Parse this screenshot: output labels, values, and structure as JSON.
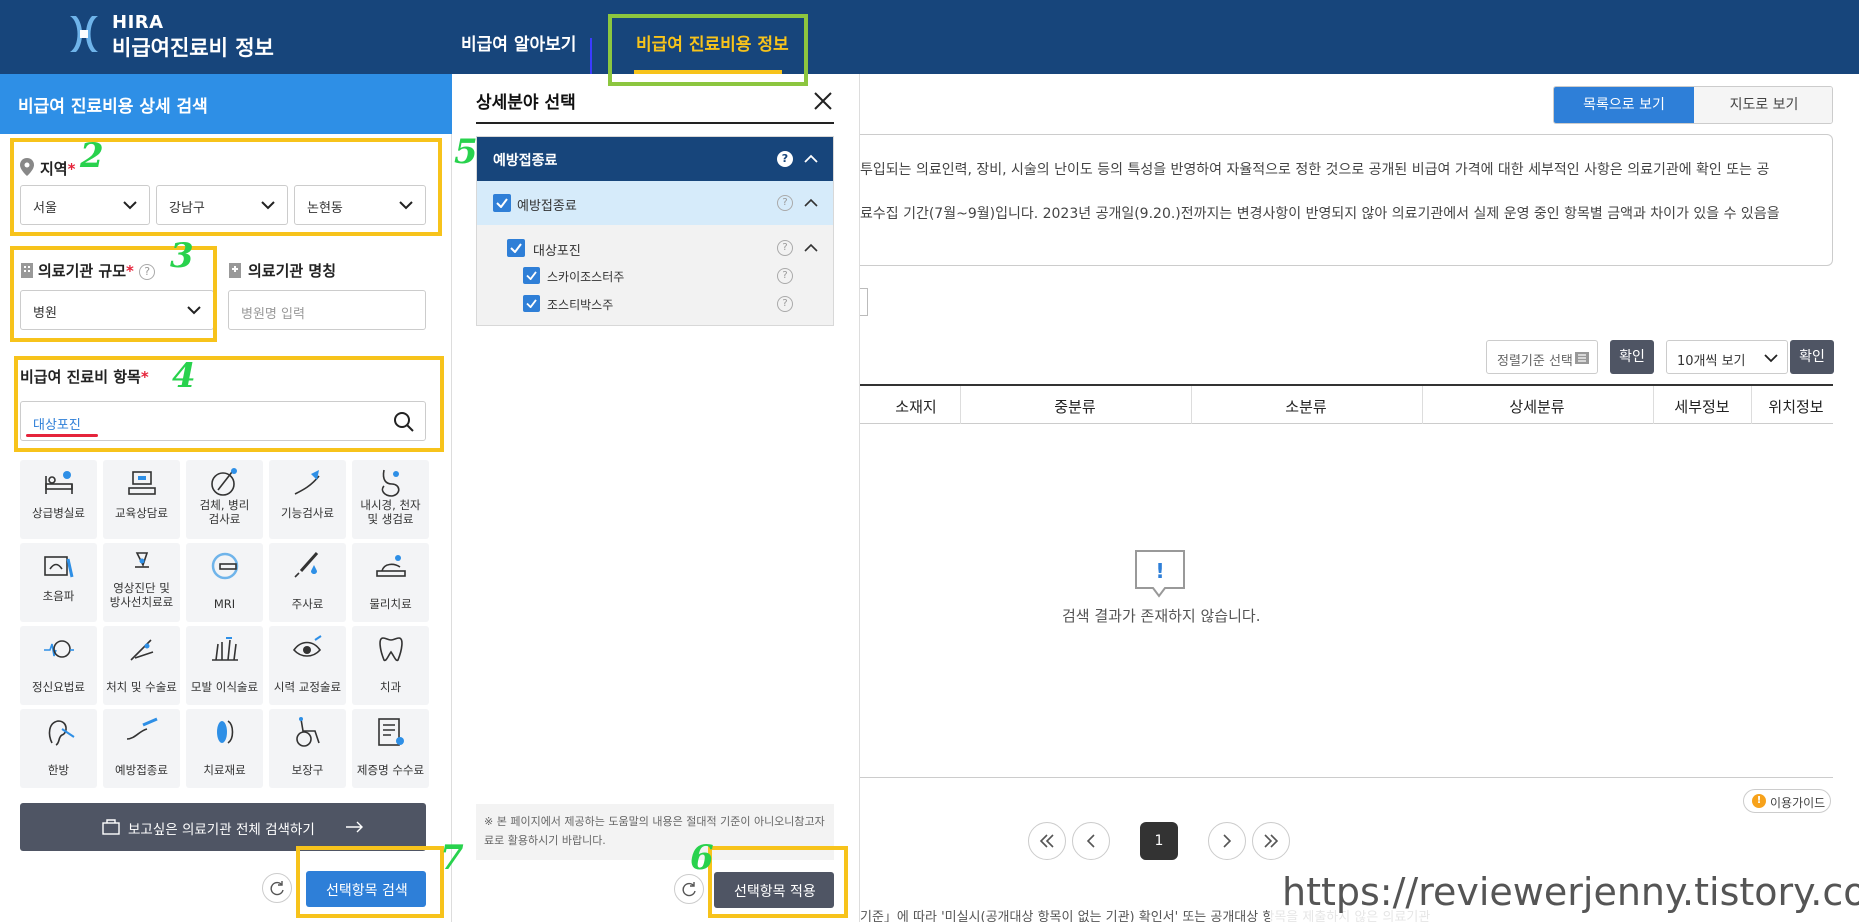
{
  "header": {
    "brand_line1": "HIRA",
    "brand_line2": "비급여진료비 정보",
    "nav": [
      "비급여 알아보기",
      "비급여 진료비용 정보"
    ]
  },
  "search_panel": {
    "title": "비급여 진료비용 상세 검색",
    "region_label": "지역",
    "region_values": [
      "서울",
      "강남구",
      "논현동"
    ],
    "scale_label": "의료기관 규모",
    "scale_value": "병원",
    "name_label": "의료기관 명칭",
    "name_placeholder": "병원명 입력",
    "item_label": "비급여 진료비 항목",
    "item_value": "대상포진",
    "required_mark": "*",
    "categories": [
      "상급병실료",
      "교육상담료",
      "검체, 병리\n검사료",
      "기능검사료",
      "내시경, 천자\n및 생검료",
      "초음파",
      "영상진단 및\n방사선치료료",
      "MRI",
      "주사료",
      "물리치료",
      "정신요법료",
      "처치 및 수술료",
      "모발 이식술료",
      "시력 교정술료",
      "치과",
      "한방",
      "예방접종료",
      "치료재료",
      "보장구",
      "제증명 수수료"
    ],
    "all_search_button": "보고싶은 의료기관 전체 검색하기",
    "search_button": "선택항목 검색"
  },
  "detail_popup": {
    "title": "상세분야 선택",
    "group": "예방접종료",
    "subgroup": "예방접종료",
    "item": "대상포진",
    "children": [
      "스카이조스터주",
      "조스티박스주"
    ],
    "notice": "※ 본 페이지에서 제공하는 도움말의 내용은 절대적 기준이 아니오니참고자료로 활용하시기 바랍니다.",
    "apply_button": "선택항목 적용"
  },
  "results": {
    "view_list": "목록으로 보기",
    "view_map": "지도로 보기",
    "info_line1": "투입되는 의료인력, 장비, 시술의 난이도 등의 특성을 반영하여 자율적으로 정한 것으로 공개된 비급여 가격에 대한 세부적인 사항은 의료기관에 확인 또는 공",
    "info_line2": "료수집 기간(7월~9월)입니다. 2023년 공개일(9.20.)전까지는 변경사항이 반영되지 않아 의료기관에서 실제 운영 중인 항목별 금액과 차이가 있을 수 있음을",
    "sort_label": "정렬기준 선택",
    "confirm": "확인",
    "per_page": "10개씩 보기",
    "columns": [
      "소재지",
      "중분류",
      "소분류",
      "상세분류",
      "세부정보",
      "위치정보"
    ],
    "empty_message": "검색 결과가 존재하지 않습니다.",
    "guide": "이용가이드",
    "current_page": "1",
    "bottom_text": "기준」에 따라 '미실시(공개대상 항목이 없는 기관) 확인서' 또는 공개대상 항목을 제출하지 않은 의료기관"
  },
  "annotations": {
    "marks": [
      "2",
      "3",
      "4",
      "5",
      "6",
      "7"
    ]
  },
  "watermark": "https://reviewerjenny.tistory.com",
  "colors": {
    "header": "#17457b",
    "accent": "#2e8fe6",
    "highlight": "#f7c31b",
    "annotation_green": "#28d24d"
  }
}
